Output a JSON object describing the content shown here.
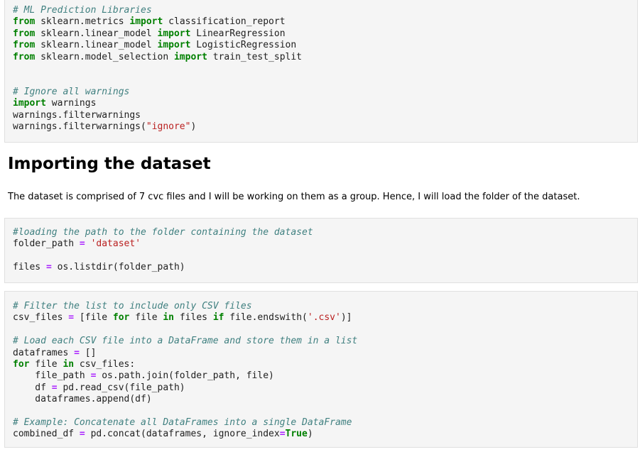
{
  "cells": {
    "imports": [
      "# ML Prediction Libraries",
      "from sklearn.metrics import classification_report",
      "from sklearn.linear_model import LinearRegression",
      "from sklearn.linear_model import LogisticRegression",
      "from sklearn.model_selection import train_test_split",
      "",
      "",
      "# Ignore all warnings",
      "import warnings",
      "warnings.filterwarnings",
      "warnings.filterwarnings(\"ignore\")"
    ],
    "load_path": [
      "#loading the path to the folder containing the dataset",
      "folder_path = 'dataset'",
      "",
      "files = os.listdir(folder_path)"
    ],
    "concat": [
      "# Filter the list to include only CSV files",
      "csv_files = [file for file in files if file.endswith('.csv')]",
      "",
      "# Load each CSV file into a DataFrame and store them in a list",
      "dataframes = []",
      "for file in csv_files:",
      "    file_path = os.path.join(folder_path, file)",
      "    df = pd.read_csv(file_path)",
      "    dataframes.append(df)",
      "",
      "# Example: Concatenate all DataFrames into a single DataFrame",
      "combined_df = pd.concat(dataframes, ignore_index=True)"
    ]
  },
  "markdown": {
    "heading": "Importing the dataset",
    "paragraph": "The dataset is comprised of 7 cvc files and I will be working on them as a group. Hence, I will load the folder of the dataset."
  },
  "colors": {
    "cell_background": "#f5f5f5",
    "cell_border": "#e0e0e0",
    "comment": "#408080",
    "keyword": "#008000",
    "operator": "#aa22ff",
    "string": "#ba2121"
  }
}
